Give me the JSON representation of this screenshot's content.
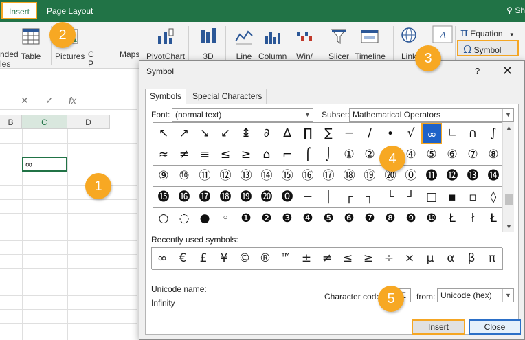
{
  "ribbon_tabs": {
    "insert": "Insert",
    "page_layout": "Page Layout",
    "share": "Sh"
  },
  "ribbon": {
    "recommended_partial": "nded",
    "recommended_partial2": "les",
    "table": "Table",
    "pictures": "Pictures",
    "pictures_partial": "C",
    "pictures_partial2": "P",
    "maps": "Maps",
    "pivotchart": "PivotChart",
    "three_d": "3D",
    "line": "Line",
    "column": "Column",
    "winloss": "Win/",
    "slicer": "Slicer",
    "timeline": "Timeline",
    "link": "Link",
    "equation": "Equation",
    "symbol": "Symbol"
  },
  "formula_bar": {
    "cancel": "✕",
    "enter": "✓",
    "fx": "fx"
  },
  "sheet": {
    "columns": [
      "B",
      "C",
      "D"
    ],
    "selected_cell_value": "∞"
  },
  "callouts": [
    "1",
    "2",
    "3",
    "4",
    "5"
  ],
  "dialog": {
    "title": "Symbol",
    "help": "?",
    "close": "✕",
    "tabs": {
      "symbols": "Symbols",
      "special": "Special Characters"
    },
    "font_label": "Font:",
    "font_value": "(normal text)",
    "subset_label": "Subset:",
    "subset_value": "Mathematical Operators",
    "grid_rows": [
      [
        "↖",
        "↗",
        "↘",
        "↙",
        "↨",
        "∂",
        "∆",
        "∏",
        "∑",
        "−",
        "∕",
        "∙",
        "√",
        "∞",
        "∟",
        "∩",
        "∫"
      ],
      [
        "≈",
        "≠",
        "≡",
        "≤",
        "≥",
        "⌂",
        "⌐",
        "⌠",
        "⌡",
        "①",
        "②",
        "③",
        "④",
        "⑤",
        "⑥",
        "⑦",
        "⑧"
      ],
      [
        "⑨",
        "⑩",
        "⑪",
        "⑫",
        "⑬",
        "⑭",
        "⑮",
        "⑯",
        "⑰",
        "⑱",
        "⑲",
        "⑳",
        "⓪",
        "⓫",
        "⓬",
        "⓭",
        "⓮"
      ],
      [
        "⓯",
        "⓰",
        "⓱",
        "⓲",
        "⓳",
        "⓴",
        "⓿",
        "─",
        "│",
        "┌",
        "┐",
        "└",
        "┘",
        "□",
        "▪",
        "▫",
        "◊"
      ],
      [
        "○",
        "◌",
        "●",
        "◦",
        "❶",
        "❷",
        "❸",
        "❹",
        "❺",
        "❻",
        "❼",
        "❽",
        "❾",
        "❿",
        "Ł",
        "ł",
        "Ł"
      ]
    ],
    "recent_label": "Recently used symbols:",
    "recent": [
      "∞",
      "€",
      "£",
      "¥",
      "©",
      "®",
      "™",
      "±",
      "≠",
      "≤",
      "≥",
      "÷",
      "×",
      "µ",
      "α",
      "β",
      "π"
    ],
    "unicode_name_label": "Unicode name:",
    "unicode_name": "Infinity",
    "char_code_label": "Character code:",
    "char_code": "221E",
    "from_label": "from:",
    "from_value": "Unicode (hex)",
    "insert_button": "Insert",
    "close_button": "Close"
  },
  "colors": {
    "excel_green": "#217346",
    "callout": "#f7a823",
    "selection": "#1e62c8"
  }
}
